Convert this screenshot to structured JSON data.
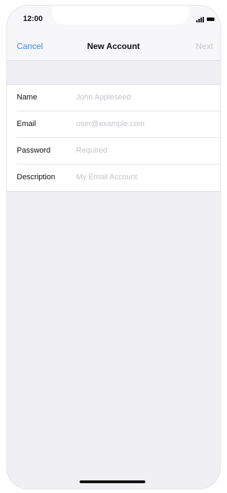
{
  "status_bar": {
    "time": "12:00",
    "signal_icon": "cellular-signal-icon",
    "battery_icon": "battery-icon"
  },
  "nav": {
    "cancel_label": "Cancel",
    "title": "New Account",
    "next_label": "Next"
  },
  "form": {
    "fields": [
      {
        "label": "Name",
        "value": "",
        "placeholder": "John Appleseed"
      },
      {
        "label": "Email",
        "value": "",
        "placeholder": "user@example.com"
      },
      {
        "label": "Password",
        "value": "",
        "placeholder": "Required"
      },
      {
        "label": "Description",
        "value": "",
        "placeholder": "My Email Account"
      }
    ]
  },
  "colors": {
    "accent": "#3a86f2",
    "disabled": "#c7c7cc",
    "background": "#efeff4"
  }
}
